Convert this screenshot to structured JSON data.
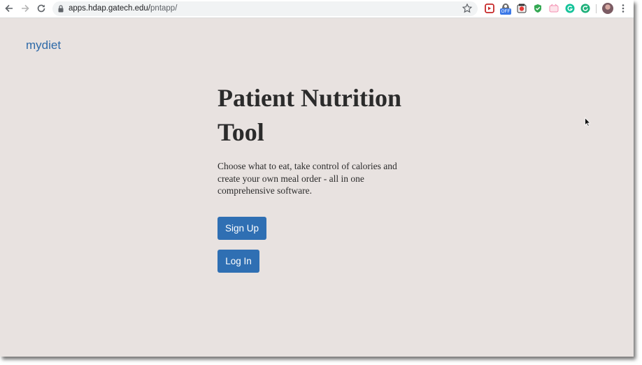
{
  "browser": {
    "url_host": "apps.hdap.gatech.edu/",
    "url_path": "pntapp/",
    "extensions": [
      "red-extension-icon",
      "off-badge-extension-icon",
      "colorful-extension-icon",
      "green-shield-extension-icon",
      "pink-extension-icon",
      "grammarly-extension-icon",
      "green-refresh-extension-icon"
    ],
    "ext_badge": "OFF"
  },
  "header": {
    "brand": "mydiet"
  },
  "hero": {
    "title_line1": "Patient Nutrition",
    "title_line2": "Tool",
    "description": "Choose what to eat, take control of calories and create your own meal order - all in one comprehensive software."
  },
  "actions": {
    "signup_label": "Sign Up",
    "login_label": "Log In"
  },
  "colors": {
    "page_bg": "#e8e2e0",
    "brand": "#2e6aa8",
    "button_bg": "#2f6fb3",
    "text": "#2b2b2b"
  }
}
